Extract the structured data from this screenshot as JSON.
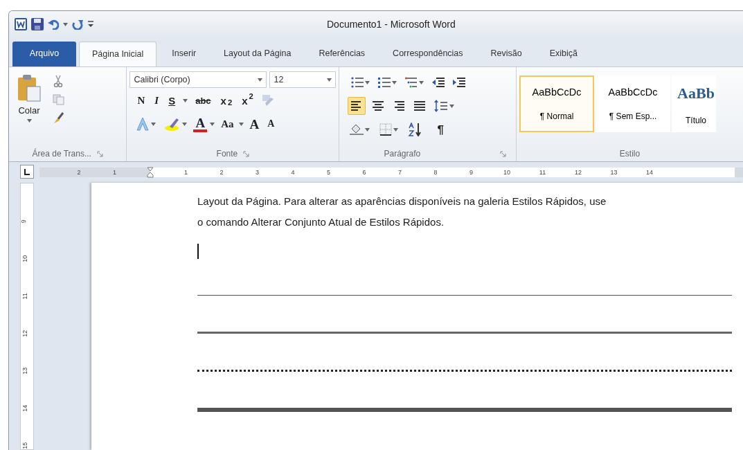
{
  "window": {
    "title": "Documento1 - Microsoft Word"
  },
  "tabs": [
    {
      "label": "Arquivo",
      "kind": "file",
      "selected": false
    },
    {
      "label": "Página Inicial",
      "kind": "tab",
      "selected": true
    },
    {
      "label": "Inserir",
      "kind": "tab",
      "selected": false
    },
    {
      "label": "Layout da Página",
      "kind": "tab",
      "selected": false
    },
    {
      "label": "Referências",
      "kind": "tab",
      "selected": false
    },
    {
      "label": "Correspondências",
      "kind": "tab",
      "selected": false
    },
    {
      "label": "Revisão",
      "kind": "tab",
      "selected": false
    },
    {
      "label": "Exibiçã",
      "kind": "tab",
      "selected": false
    }
  ],
  "clipboard": {
    "paste_label": "Colar",
    "group_label": "Área de Trans..."
  },
  "font": {
    "font_name": "Calibri (Corpo)",
    "font_size": "12",
    "group_label": "Fonte",
    "row1": [
      {
        "kind": "bold",
        "label": "N"
      },
      {
        "kind": "italic",
        "label": "I"
      },
      {
        "kind": "underline",
        "label": "S"
      },
      {
        "kind": "strike",
        "label": "abc"
      },
      {
        "kind": "sub",
        "label": "x$_{2}$"
      },
      {
        "kind": "sup",
        "label": "x$^{2}$"
      }
    ],
    "row2": [
      {
        "kind": "color",
        "label": "A"
      },
      {
        "kind": "case",
        "label": "Aa"
      },
      {
        "kind": "grow",
        "label": "A"
      },
      {
        "kind": "shrink",
        "label": "A"
      }
    ]
  },
  "paragraph": {
    "group_label": "Parágrafo",
    "alignments": [
      {
        "kind": "left",
        "selected": true
      },
      {
        "kind": "center",
        "selected": false
      },
      {
        "kind": "right",
        "selected": false
      },
      {
        "kind": "justify",
        "selected": false
      }
    ],
    "pilcrow": "¶"
  },
  "styles": {
    "group_label": "Estilo",
    "items": [
      {
        "preview": "AaBbCcDc",
        "name": "¶ Normal",
        "kind": "body",
        "selected": true
      },
      {
        "preview": "AaBbCcDc",
        "name": "¶ Sem Esp...",
        "kind": "body",
        "selected": false
      },
      {
        "preview": "AaBb",
        "name": "Título",
        "kind": "heading",
        "selected": false
      }
    ]
  },
  "ruler": {
    "left_labels": [
      "2",
      "1"
    ],
    "labels": [
      "1",
      "2",
      "3",
      "4",
      "5",
      "6",
      "7",
      "8",
      "9",
      "10",
      "11",
      "12",
      "13",
      "14"
    ],
    "vertical_labels": [
      "9",
      "10",
      "11",
      "12",
      "13",
      "14",
      "15"
    ]
  },
  "document": {
    "paragraph_lines": [
      "Layout da Página. Para alterar as aparências disponíveis na galeria Estilos Rápidos, use",
      "o comando Alterar Conjunto Atual de Estilos Rápidos."
    ],
    "rules": [
      {
        "kind": "thin"
      },
      {
        "kind": "medium"
      },
      {
        "kind": "dotted"
      },
      {
        "kind": "thick"
      }
    ]
  }
}
